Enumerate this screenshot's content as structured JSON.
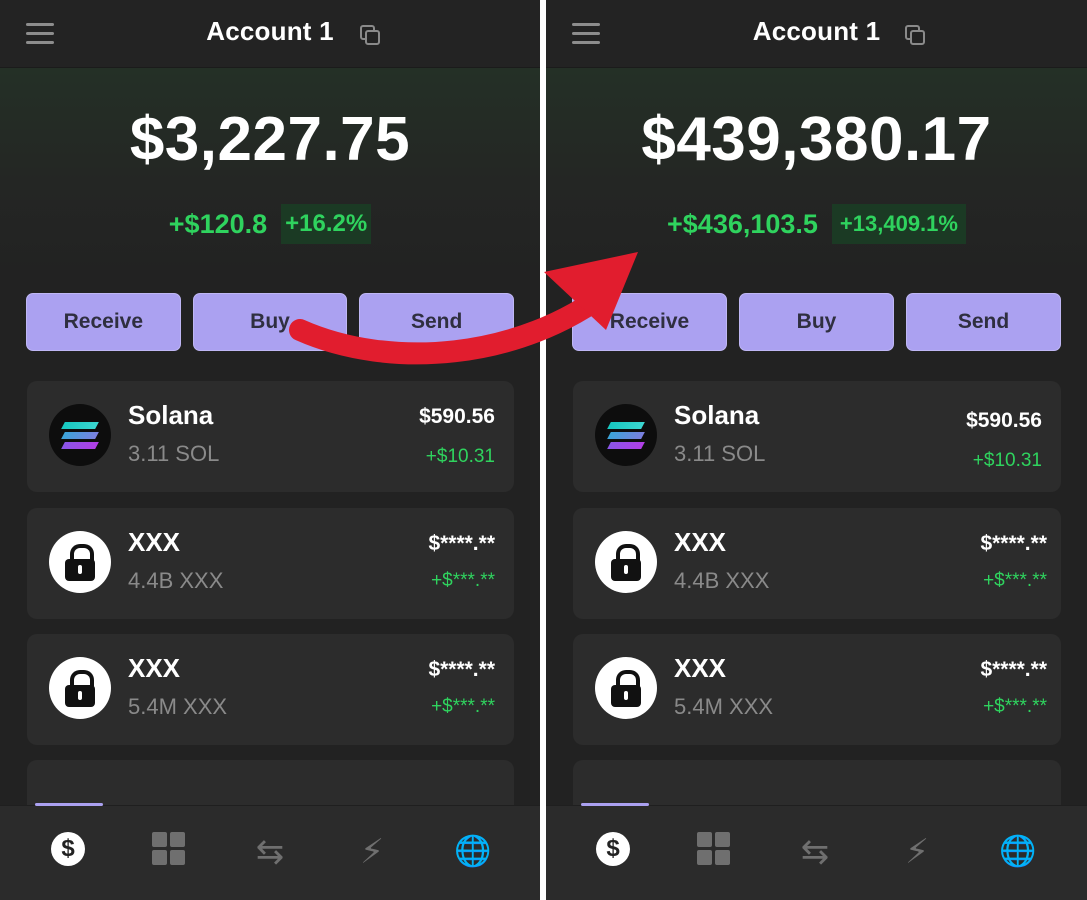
{
  "screens": [
    {
      "header": {
        "title": "Account 1"
      },
      "balance": "$3,227.75",
      "change_abs": "+$120.8",
      "change_pct": "+16.2%",
      "actions": [
        "Receive",
        "Buy",
        "Send"
      ],
      "tokens": [
        {
          "name": "Solana",
          "amount": "3.11 SOL",
          "value": "$590.56",
          "change": "+$10.31",
          "icon": "solana-icon"
        },
        {
          "name": "XXX",
          "amount": "4.4B XXX",
          "value": "$****.**",
          "change": "+$***.**",
          "icon": "lock-icon"
        },
        {
          "name": "XXX",
          "amount": "5.4M XXX",
          "value": "$****.**",
          "change": "+$***.**",
          "icon": "lock-icon"
        }
      ]
    },
    {
      "header": {
        "title": "Account 1"
      },
      "balance": "$439,380.17",
      "change_abs": "+$436,103.5",
      "change_pct": "+13,409.1%",
      "actions": [
        "Receive",
        "Buy",
        "Send"
      ],
      "tokens": [
        {
          "name": "Solana",
          "amount": "3.11 SOL",
          "value": "$590.56",
          "change": "+$10.31",
          "icon": "solana-icon"
        },
        {
          "name": "XXX",
          "amount": "4.4B XXX",
          "value": "$****.**",
          "change": "+$***.**",
          "icon": "lock-icon"
        },
        {
          "name": "XXX",
          "amount": "5.4M XXX",
          "value": "$****.**",
          "change": "+$***.**",
          "icon": "lock-icon"
        }
      ]
    }
  ],
  "nav": {
    "items": [
      "dollar-icon",
      "grid-icon",
      "swap-icon",
      "lightning-icon",
      "globe-icon"
    ],
    "dollar_glyph": "$",
    "swap_glyph": "⇆",
    "lightning_glyph": "⚡",
    "globe_glyph": "🌐"
  },
  "colors": {
    "accent": "#aba1f1",
    "positive": "#2fd35e",
    "background": "#222222",
    "arrow": "#e11d2e"
  }
}
